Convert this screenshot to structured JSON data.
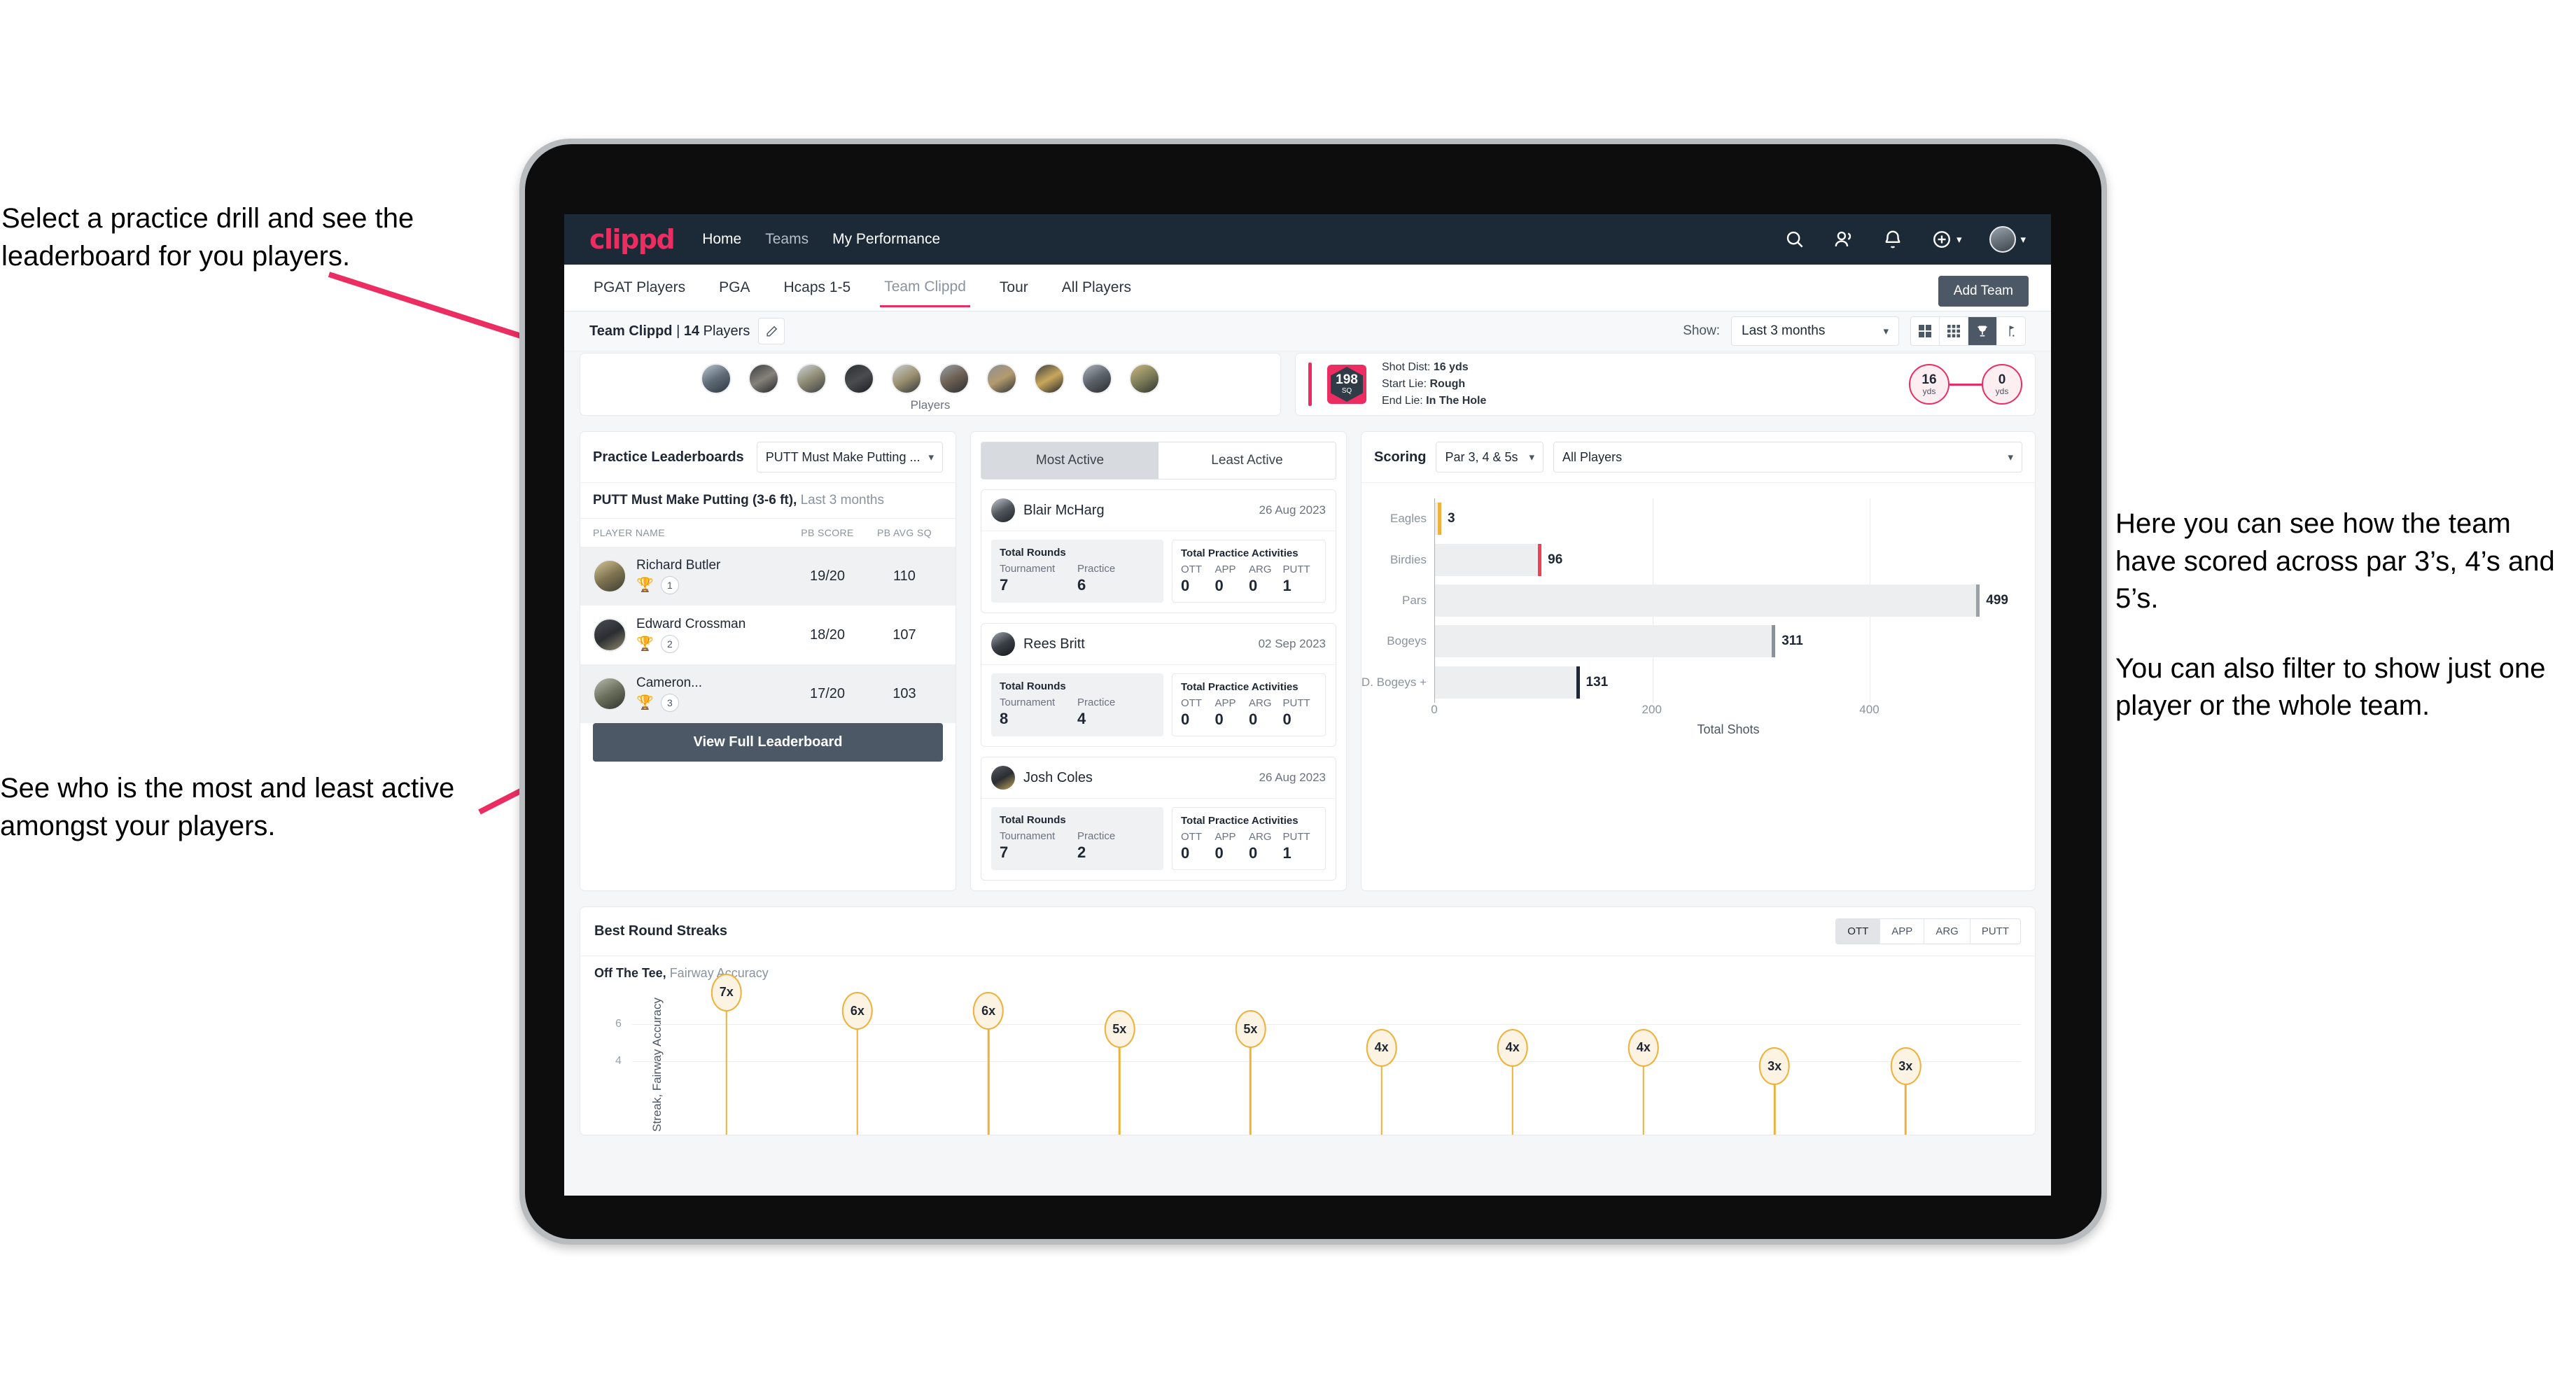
{
  "annotations": {
    "top_left": "Select a practice drill and see the leaderboard for you players.",
    "bottom_left": "See who is the most and least active amongst your players.",
    "right_1": "Here you can see how the team have scored across par 3’s, 4’s and 5’s.",
    "right_2": "You can also filter to show just one player or the whole team."
  },
  "appbar": {
    "logo": "clippd",
    "nav": [
      {
        "label": "Home",
        "active": true
      },
      {
        "label": "Teams",
        "active": false
      },
      {
        "label": "My Performance",
        "active": true
      }
    ],
    "icons": [
      "search-icon",
      "people-icon",
      "bell-icon",
      "plus-circle-icon",
      "avatar"
    ]
  },
  "tabs": [
    {
      "label": "PGAT Players",
      "active": false
    },
    {
      "label": "PGA",
      "active": false
    },
    {
      "label": "Hcaps 1-5",
      "active": false
    },
    {
      "label": "Team Clippd",
      "active": true
    },
    {
      "label": "Tour",
      "active": false
    },
    {
      "label": "All Players",
      "active": false
    }
  ],
  "add_team_label": "Add Team",
  "subbar": {
    "team_name": "Team Clippd",
    "separator": " | ",
    "player_count": "14",
    "players_word": " Players",
    "edit_icon": "pencil-icon",
    "show_label": "Show:",
    "range_value": "Last 3 months",
    "view_modes": [
      {
        "icon": "grid-large-icon",
        "active": false
      },
      {
        "icon": "grid-small-icon",
        "active": false
      },
      {
        "icon": "trophy-icon",
        "active": true
      },
      {
        "icon": "flag-icon",
        "active": false
      }
    ]
  },
  "players_strip": {
    "caption": "Players",
    "avatar_count": 10
  },
  "shot_card": {
    "sq_value": "198",
    "sq_unit": "SQ",
    "lines": [
      {
        "label": "Shot Dist: ",
        "value": "16 yds"
      },
      {
        "label": "Start Lie: ",
        "value": "Rough"
      },
      {
        "label": "End Lie: ",
        "value": "In The Hole"
      }
    ],
    "start_dist": "16",
    "start_unit": "yds",
    "end_dist": "0",
    "end_unit": "yds"
  },
  "leaderboard": {
    "title": "Practice Leaderboards",
    "drill_select": "PUTT Must Make Putting ...",
    "subtitle_bold": "PUTT Must Make Putting (3-6 ft),",
    "subtitle_rest": " Last 3 months",
    "columns": [
      "PLAYER NAME",
      "PB SCORE",
      "PB AVG SQ"
    ],
    "rows": [
      {
        "name": "Richard Butler",
        "rank": "1",
        "trophy": "gold",
        "pb_score": "19/20",
        "pb_avg_sq": "110"
      },
      {
        "name": "Edward Crossman",
        "rank": "2",
        "trophy": "silver",
        "pb_score": "18/20",
        "pb_avg_sq": "107"
      },
      {
        "name": "Cameron...",
        "rank": "3",
        "trophy": "bronze",
        "pb_score": "17/20",
        "pb_avg_sq": "103"
      }
    ],
    "button": "View Full Leaderboard"
  },
  "activity": {
    "tabs": [
      {
        "label": "Most Active",
        "active": true
      },
      {
        "label": "Least Active",
        "active": false
      }
    ],
    "rounds_title": "Total Rounds",
    "rounds_labels": [
      "Tournament",
      "Practice"
    ],
    "practice_title": "Total Practice Activities",
    "practice_labels": [
      "OTT",
      "APP",
      "ARG",
      "PUTT"
    ],
    "cards": [
      {
        "name": "Blair McHarg",
        "date": "26 Aug 2023",
        "tournament": "7",
        "practice": "6",
        "ott": "0",
        "app": "0",
        "arg": "0",
        "putt": "1"
      },
      {
        "name": "Rees Britt",
        "date": "02 Sep 2023",
        "tournament": "8",
        "practice": "4",
        "ott": "0",
        "app": "0",
        "arg": "0",
        "putt": "0"
      },
      {
        "name": "Josh Coles",
        "date": "26 Aug 2023",
        "tournament": "7",
        "practice": "2",
        "ott": "0",
        "app": "0",
        "arg": "0",
        "putt": "1"
      }
    ]
  },
  "scoring": {
    "title": "Scoring",
    "par_select": "Par 3, 4 & 5s",
    "player_select": "All Players"
  },
  "streaks": {
    "title": "Best Round Streaks",
    "segments": [
      {
        "label": "OTT",
        "active": true
      },
      {
        "label": "APP",
        "active": false
      },
      {
        "label": "ARG",
        "active": false
      },
      {
        "label": "PUTT",
        "active": false
      }
    ],
    "subtitle_bold": "Off The Tee,",
    "subtitle_rest": " Fairway Accuracy"
  },
  "chart_data": [
    {
      "type": "bar",
      "orientation": "horizontal",
      "title": "Scoring",
      "categories": [
        "Eagles",
        "Birdies",
        "Pars",
        "Bogeys",
        "D. Bogeys +"
      ],
      "values": [
        3,
        96,
        499,
        311,
        131
      ],
      "cap_colors": [
        "#eeb13c",
        "#ef4056",
        "#9aa1a9",
        "#8a929b",
        "#1e2733"
      ],
      "xlabel": "Total Shots",
      "ylabel": "",
      "xticks": [
        0,
        200,
        400
      ],
      "xlim": [
        0,
        540
      ],
      "grid": true,
      "legend": "none"
    },
    {
      "type": "bar",
      "subtype": "lollipop",
      "title": "Best Round Streaks",
      "ylabel": "Streak, Fairway Accuracy",
      "xlabel": "",
      "yticks": [
        4,
        6
      ],
      "ylim": [
        0,
        7.6
      ],
      "categories": [
        "p1",
        "p2",
        "p3",
        "p4",
        "p5",
        "p6",
        "p7",
        "p8",
        "p9",
        "p10"
      ],
      "values": [
        7,
        6,
        6,
        5,
        5,
        4,
        4,
        4,
        3,
        3
      ],
      "labels": [
        "7x",
        "6x",
        "6x",
        "5x",
        "5x",
        "4x",
        "4x",
        "4x",
        "3x",
        "3x"
      ],
      "grid": true,
      "legend": "none"
    }
  ],
  "colors": {
    "brand_pink": "#ec2d62",
    "navy": "#1c2a38",
    "slate": "#4c5866",
    "gold": "#eeb13c"
  }
}
